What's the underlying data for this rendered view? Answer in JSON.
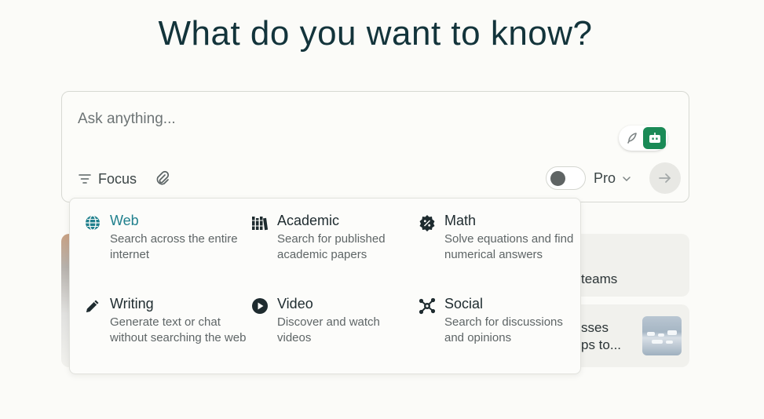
{
  "heading": "What do you want to know?",
  "ask": {
    "placeholder": "Ask anything...",
    "focus_label": "Focus",
    "pro_label": "Pro",
    "pro_enabled": false
  },
  "focus_options": [
    {
      "name": "Web",
      "description": "Search across the entire internet",
      "icon": "globe-icon",
      "selected": true
    },
    {
      "name": "Academic",
      "description": "Search for published academic papers",
      "icon": "books-icon",
      "selected": false
    },
    {
      "name": "Math",
      "description": "Solve equations and find numerical answers",
      "icon": "percent-badge-icon",
      "selected": false
    },
    {
      "name": "Writing",
      "description": "Generate text or chat without searching the web",
      "icon": "pencil-icon",
      "selected": false
    },
    {
      "name": "Video",
      "description": "Discover and watch videos",
      "icon": "play-icon",
      "selected": false
    },
    {
      "name": "Social",
      "description": "Search for discussions and opinions",
      "icon": "network-icon",
      "selected": false
    }
  ],
  "cards": {
    "card1_text": "teams",
    "card2_line1": "sses",
    "card2_line2": "ps to..."
  },
  "colors": {
    "accent": "#20808d",
    "title": "#13343b",
    "model_active": "#1a8a56"
  }
}
